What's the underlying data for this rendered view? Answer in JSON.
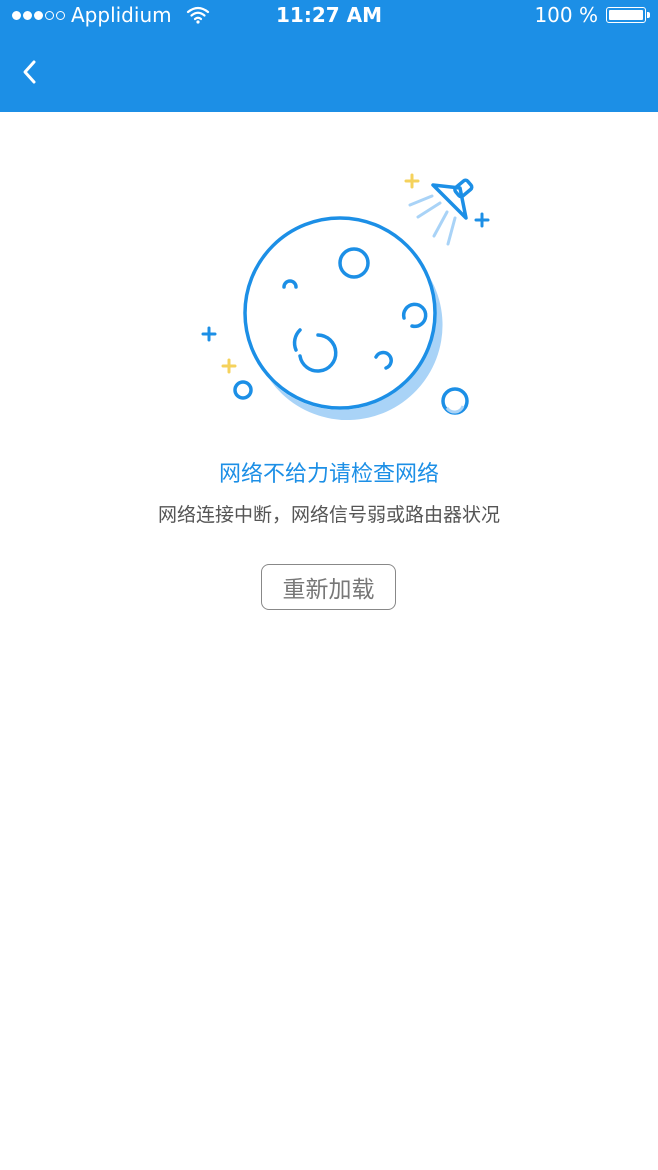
{
  "status_bar": {
    "carrier": "Applidium",
    "time": "11:27 AM",
    "battery_percent": "100 %",
    "signal_strength": 3,
    "signal_max": 5
  },
  "nav": {
    "back_icon": "chevron-left-icon"
  },
  "empty_state": {
    "illustration": "moon-with-flashlight",
    "title": "网络不给力请检查网络",
    "subtitle": "网络连接中断，网络信号弱或路由器状况",
    "reload_label": "重新加载"
  },
  "colors": {
    "header_bg": "#1c8fe6",
    "title": "#1c8fe6",
    "subtitle": "#555555",
    "button_border": "#888888",
    "button_text": "#777777",
    "accent_yellow": "#f5d25c",
    "moon_shadow": "#a9d3f7"
  }
}
